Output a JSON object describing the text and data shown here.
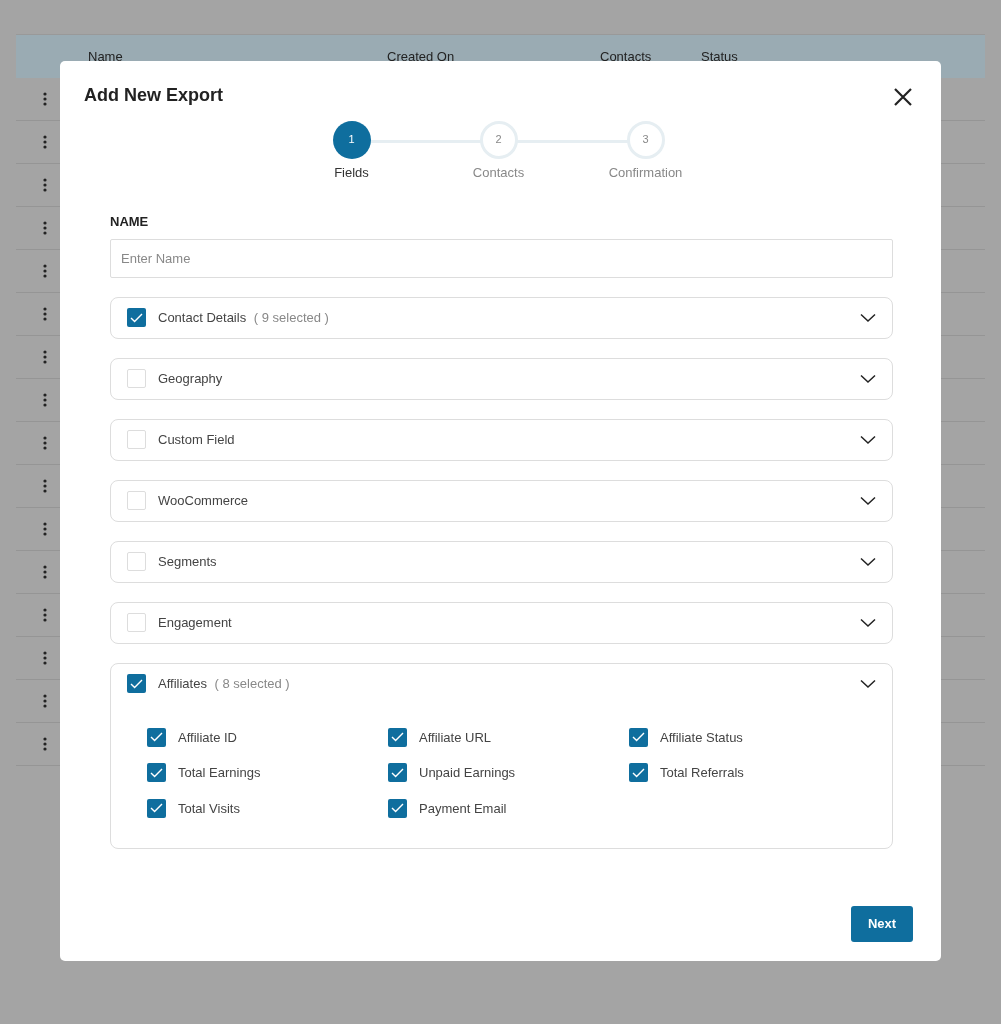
{
  "table": {
    "columns": [
      "Name",
      "Created On",
      "Contacts",
      "Status"
    ],
    "rows": [
      {
        "has_menu": true
      },
      {
        "has_menu": true
      },
      {
        "has_menu": true
      },
      {
        "has_menu": true
      },
      {
        "has_menu": true
      },
      {
        "has_menu": true
      },
      {
        "has_menu": true
      },
      {
        "has_menu": true
      },
      {
        "has_menu": true
      },
      {
        "has_menu": true
      },
      {
        "has_menu": true
      },
      {
        "has_menu": true
      },
      {
        "has_menu": true
      },
      {
        "has_menu": true
      },
      {
        "has_menu": true
      },
      {
        "has_menu": true
      }
    ]
  },
  "modal": {
    "title": "Add New Export",
    "steps": [
      {
        "number": "1",
        "label": "Fields",
        "selected": true
      },
      {
        "number": "2",
        "label": "Contacts",
        "selected": false
      },
      {
        "number": "3",
        "label": "Confirmation",
        "selected": false
      }
    ],
    "name_field": {
      "label": "NAME",
      "placeholder": "Enter Name"
    },
    "sections": [
      {
        "label": "Contact Details",
        "count": "( 9 selected )",
        "checked": true
      },
      {
        "label": "Geography",
        "checked": false
      },
      {
        "label": "Custom Field",
        "checked": false
      },
      {
        "label": "WooCommerce",
        "checked": false
      },
      {
        "label": "Segments",
        "checked": false
      },
      {
        "label": "Engagement",
        "checked": false
      },
      {
        "label": "Affiliates",
        "count": "( 8 selected )",
        "checked": true,
        "options": [
          {
            "label": "Affiliate ID",
            "checked": true
          },
          {
            "label": "Affiliate URL",
            "checked": true
          },
          {
            "label": "Affiliate Status",
            "checked": true
          },
          {
            "label": "Total Earnings",
            "checked": true
          },
          {
            "label": "Unpaid Earnings",
            "checked": true
          },
          {
            "label": "Total Referrals",
            "checked": true
          },
          {
            "label": "Total Visits",
            "checked": true
          },
          {
            "label": "Payment Email",
            "checked": true
          }
        ]
      }
    ],
    "next_button": "Next"
  }
}
